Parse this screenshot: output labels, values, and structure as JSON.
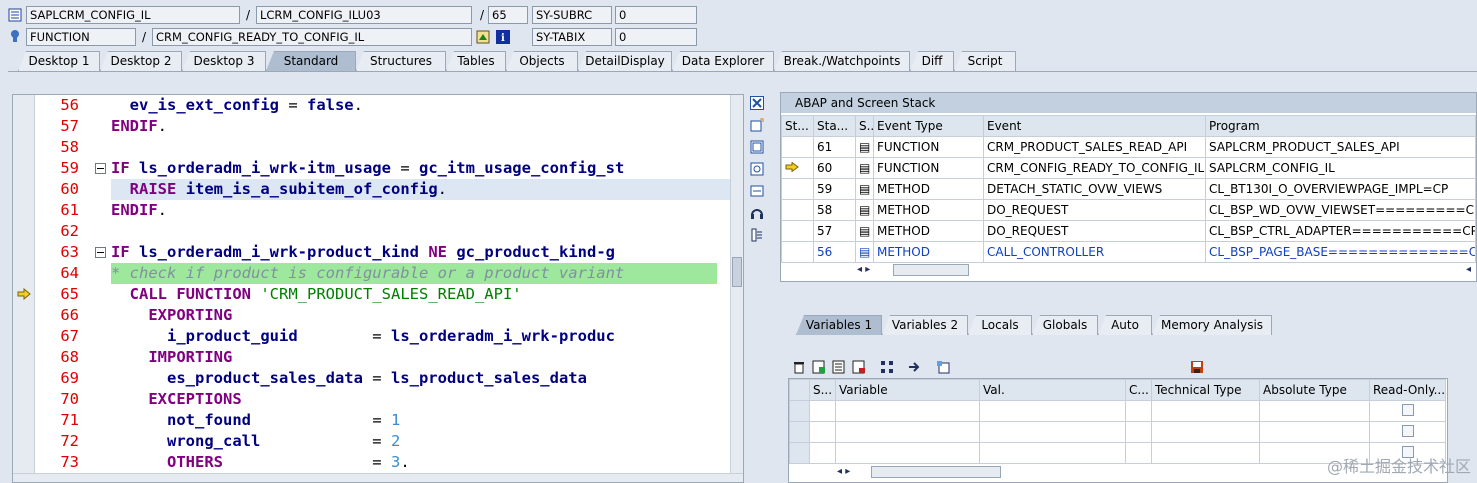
{
  "header": {
    "row1": {
      "program": "SAPLCRM_CONFIG_IL",
      "include": "LCRM_CONFIG_ILU03",
      "line": "65",
      "sysvar": "SY-SUBRC",
      "sysval": "0"
    },
    "row2": {
      "type": "FUNCTION",
      "name": "CRM_CONFIG_READY_TO_CONFIG_IL",
      "sysvar": "SY-TABIX",
      "sysval": "0"
    },
    "slash": "/"
  },
  "tabs": [
    "Desktop 1",
    "Desktop 2",
    "Desktop 3",
    "Standard",
    "Structures",
    "Tables",
    "Objects",
    "DetailDisplay",
    "Data Explorer",
    "Break./Watchpoints",
    "Diff",
    "Script"
  ],
  "code": {
    "lines": [
      "56",
      "57",
      "58",
      "59",
      "60",
      "61",
      "62",
      "63",
      "64",
      "65",
      "66",
      "67",
      "68",
      "69",
      "70",
      "71",
      "72",
      "73"
    ]
  },
  "stack": {
    "title": "ABAP and Screen Stack",
    "headers": [
      "St...",
      "Sta...",
      "S...",
      "Event Type",
      "Event",
      "Program"
    ],
    "rows": [
      {
        "num": "61",
        "etype": "FUNCTION",
        "event": "CRM_PRODUCT_SALES_READ_API",
        "program": "SAPLCRM_PRODUCT_SALES_API"
      },
      {
        "num": "60",
        "etype": "FUNCTION",
        "event": "CRM_CONFIG_READY_TO_CONFIG_IL",
        "program": "SAPLCRM_CONFIG_IL"
      },
      {
        "num": "59",
        "etype": "METHOD",
        "event": "DETACH_STATIC_OVW_VIEWS",
        "program": "CL_BT130I_O_OVERVIEWPAGE_IMPL=CP"
      },
      {
        "num": "58",
        "etype": "METHOD",
        "event": "DO_REQUEST",
        "program": "CL_BSP_WD_OVW_VIEWSET=========CP"
      },
      {
        "num": "57",
        "etype": "METHOD",
        "event": "DO_REQUEST",
        "program": "CL_BSP_CTRL_ADAPTER===========CP"
      },
      {
        "num": "56",
        "etype": "METHOD",
        "event": "CALL_CONTROLLER",
        "program": "CL_BSP_PAGE_BASE==============CP"
      }
    ]
  },
  "vartabs": [
    "Variables 1",
    "Variables 2",
    "Locals",
    "Globals",
    "Auto",
    "Memory Analysis"
  ],
  "vars": {
    "headers": [
      "S...",
      "Variable",
      "Val.",
      "C...",
      "Technical Type",
      "Absolute Type",
      "Read-Only..."
    ]
  },
  "watermark": "@稀土掘金技术社区"
}
